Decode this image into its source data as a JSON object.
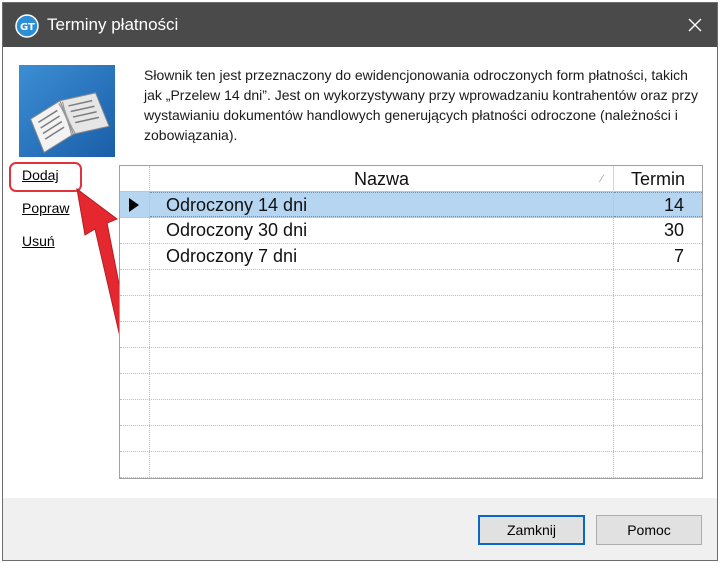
{
  "window": {
    "title": "Terminy płatności"
  },
  "description": "Słownik ten jest przeznaczony do ewidencjonowania odroczonych form płatności, takich jak „Przelew 14 dni”. Jest on wykorzystywany przy wprowadzaniu kontrahentów oraz przy wystawianiu dokumentów handlowych generujących płatności odroczone (należności i zobowiązania).",
  "actions": {
    "add": "Dodaj",
    "edit": "Popraw",
    "delete": "Usuń"
  },
  "grid": {
    "columns": {
      "name": "Nazwa",
      "term": "Termin"
    },
    "rows": [
      {
        "name": "Odroczony 14 dni",
        "term": "14",
        "selected": true
      },
      {
        "name": "Odroczony 30 dni",
        "term": "30",
        "selected": false
      },
      {
        "name": "Odroczony 7 dni",
        "term": "7",
        "selected": false
      }
    ]
  },
  "footer": {
    "close_label": "Zamknij",
    "help_label": "Pomoc"
  },
  "colors": {
    "titlebar": "#4a4a4a",
    "selection": "#b5d5f1",
    "highlight": "#e0333d",
    "focus_border": "#0a66c8"
  },
  "icons": {
    "app": "app-logo-icon",
    "close": "close-icon",
    "dictionary": "dictionary-book-icon",
    "row_pointer": "row-pointer-icon",
    "sort": "sort-indicator-icon"
  }
}
